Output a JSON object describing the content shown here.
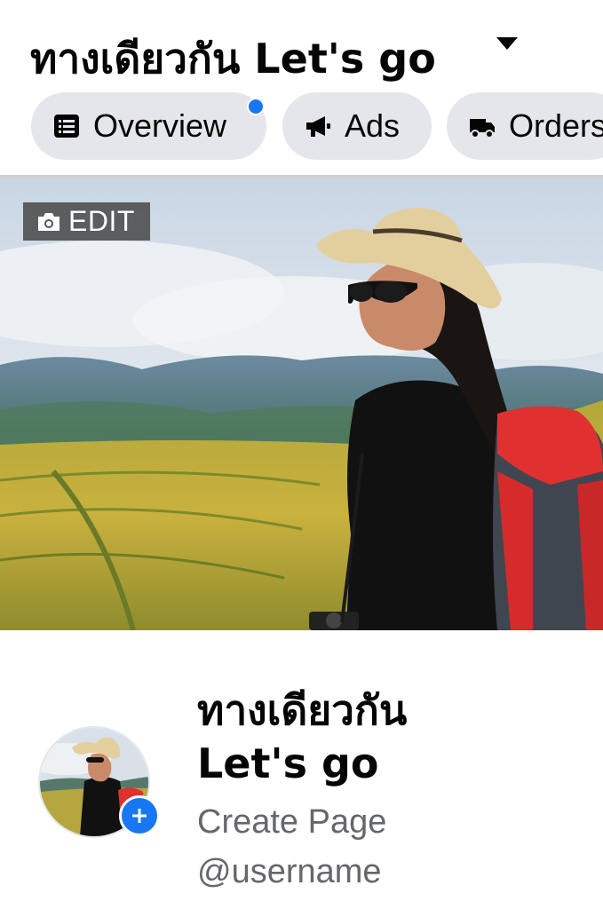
{
  "header": {
    "title": "ทางเดียวกัน Let's go",
    "caret_icon": "caret-down-icon"
  },
  "tabs": [
    {
      "label": "Overview",
      "icon": "list-icon",
      "has_notification": true
    },
    {
      "label": "Ads",
      "icon": "megaphone-icon"
    },
    {
      "label": "Orders",
      "icon": "truck-icon"
    }
  ],
  "cover": {
    "edit_label": "EDIT",
    "edit_icon": "camera-icon"
  },
  "profile": {
    "name_line1": "ทางเดียวกัน",
    "name_line2": "Let's go",
    "category": "Create Page",
    "username": "@username",
    "add_icon": "plus-icon"
  },
  "colors": {
    "accent": "#1877f2",
    "tab_bg": "#e4e6eb",
    "secondary_text": "#65676b"
  }
}
